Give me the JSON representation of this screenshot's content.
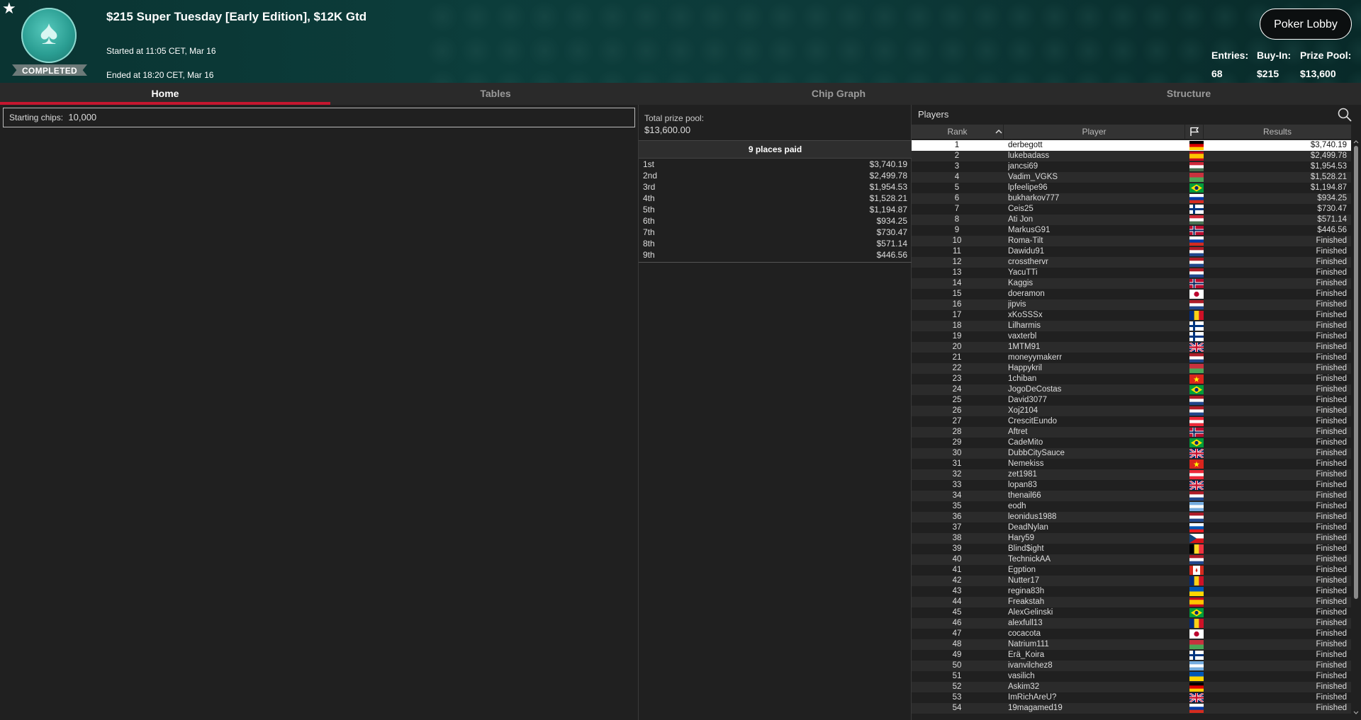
{
  "header": {
    "status_label": "COMPLETED",
    "title": "$215 Super Tuesday [Early Edition], $12K Gtd",
    "started": "Started at 11:05 CET, Mar 16",
    "ended": "Ended at 18:20 CET, Mar 16",
    "lobby_button": "Poker Lobby",
    "stats": [
      {
        "label": "Entries:",
        "value": "68"
      },
      {
        "label": "Buy-In:",
        "value": "$215"
      },
      {
        "label": "Prize Pool:",
        "value": "$13,600"
      }
    ]
  },
  "tabs": [
    {
      "label": "Home",
      "active": true
    },
    {
      "label": "Tables",
      "active": false
    },
    {
      "label": "Chip Graph",
      "active": false
    },
    {
      "label": "Structure",
      "active": false
    }
  ],
  "home": {
    "starting_chips_label": "Starting chips:",
    "starting_chips_value": "10,000"
  },
  "prize": {
    "total_label": "Total prize pool:",
    "total_value": "$13,600.00",
    "places_header": "9 places paid",
    "places": [
      {
        "place": "1st",
        "amount": "$3,740.19"
      },
      {
        "place": "2nd",
        "amount": "$2,499.78"
      },
      {
        "place": "3rd",
        "amount": "$1,954.53"
      },
      {
        "place": "4th",
        "amount": "$1,528.21"
      },
      {
        "place": "5th",
        "amount": "$1,194.87"
      },
      {
        "place": "6th",
        "amount": "$934.25"
      },
      {
        "place": "7th",
        "amount": "$730.47"
      },
      {
        "place": "8th",
        "amount": "$571.14"
      },
      {
        "place": "9th",
        "amount": "$446.56"
      }
    ]
  },
  "players": {
    "title": "Players",
    "columns": {
      "rank": "Rank",
      "player": "Player",
      "results": "Results"
    },
    "rows": [
      {
        "rank": "1",
        "name": "derbegott",
        "flag": "de",
        "result": "$3,740.19"
      },
      {
        "rank": "2",
        "name": "lukebadass",
        "flag": "es",
        "result": "$2,499.78"
      },
      {
        "rank": "3",
        "name": "jancsi69",
        "flag": "hu",
        "result": "$1,954.53"
      },
      {
        "rank": "4",
        "name": "Vadim_VGKS",
        "flag": "by",
        "result": "$1,528.21"
      },
      {
        "rank": "5",
        "name": "lpfeelipe96",
        "flag": "br",
        "result": "$1,194.87"
      },
      {
        "rank": "6",
        "name": "bukharkov777",
        "flag": "ru",
        "result": "$934.25"
      },
      {
        "rank": "7",
        "name": "Ceis25",
        "flag": "fi",
        "result": "$730.47"
      },
      {
        "rank": "8",
        "name": "Ati Jon",
        "flag": "hu",
        "result": "$571.14"
      },
      {
        "rank": "9",
        "name": "MarkusG91",
        "flag": "no",
        "result": "$446.56"
      },
      {
        "rank": "10",
        "name": "Roma-Tilt",
        "flag": "ru",
        "result": "Finished"
      },
      {
        "rank": "11",
        "name": "Dawidu91",
        "flag": "nl",
        "result": "Finished"
      },
      {
        "rank": "12",
        "name": "crossthervr",
        "flag": "nl",
        "result": "Finished"
      },
      {
        "rank": "13",
        "name": "YacuTTi",
        "flag": "nl",
        "result": "Finished"
      },
      {
        "rank": "14",
        "name": "Kaggis",
        "flag": "no",
        "result": "Finished"
      },
      {
        "rank": "15",
        "name": "doeramon",
        "flag": "jp",
        "result": "Finished"
      },
      {
        "rank": "16",
        "name": "jipvis",
        "flag": "nl",
        "result": "Finished"
      },
      {
        "rank": "17",
        "name": "xKoSSSx",
        "flag": "ro",
        "result": "Finished"
      },
      {
        "rank": "18",
        "name": "Lilharmis",
        "flag": "fi",
        "result": "Finished"
      },
      {
        "rank": "19",
        "name": "vaxterbl",
        "flag": "fi",
        "result": "Finished"
      },
      {
        "rank": "20",
        "name": "1MTM91",
        "flag": "gb",
        "result": "Finished"
      },
      {
        "rank": "21",
        "name": "moneyymakerr",
        "flag": "nl",
        "result": "Finished"
      },
      {
        "rank": "22",
        "name": "Happykril",
        "flag": "by",
        "result": "Finished"
      },
      {
        "rank": "23",
        "name": "1chiban",
        "flag": "vn",
        "result": "Finished"
      },
      {
        "rank": "24",
        "name": "JogoDeCostas",
        "flag": "br",
        "result": "Finished"
      },
      {
        "rank": "25",
        "name": "David3077",
        "flag": "nl",
        "result": "Finished"
      },
      {
        "rank": "26",
        "name": "Xoj2104",
        "flag": "nl",
        "result": "Finished"
      },
      {
        "rank": "27",
        "name": "CrescitEundo",
        "flag": "at",
        "result": "Finished"
      },
      {
        "rank": "28",
        "name": "Aftret",
        "flag": "no",
        "result": "Finished"
      },
      {
        "rank": "29",
        "name": "CadeMito",
        "flag": "br",
        "result": "Finished"
      },
      {
        "rank": "30",
        "name": "DubbCitySauce",
        "flag": "gb",
        "result": "Finished"
      },
      {
        "rank": "31",
        "name": "Nemekiss",
        "flag": "vn",
        "result": "Finished"
      },
      {
        "rank": "32",
        "name": "zet1981",
        "flag": "at",
        "result": "Finished"
      },
      {
        "rank": "33",
        "name": "lopan83",
        "flag": "gb",
        "result": "Finished"
      },
      {
        "rank": "34",
        "name": "thenail66",
        "flag": "nl",
        "result": "Finished"
      },
      {
        "rank": "35",
        "name": "eodh",
        "flag": "ar",
        "result": "Finished"
      },
      {
        "rank": "36",
        "name": "leonidus1988",
        "flag": "nl",
        "result": "Finished"
      },
      {
        "rank": "37",
        "name": "DeadNylan",
        "flag": "si",
        "result": "Finished"
      },
      {
        "rank": "38",
        "name": "Hary59",
        "flag": "cz",
        "result": "Finished"
      },
      {
        "rank": "39",
        "name": "Blind$ight",
        "flag": "be",
        "result": "Finished"
      },
      {
        "rank": "40",
        "name": "TechnickAA",
        "flag": "nl",
        "result": "Finished"
      },
      {
        "rank": "41",
        "name": "Egption",
        "flag": "ca",
        "result": "Finished"
      },
      {
        "rank": "42",
        "name": "Nutter17",
        "flag": "ro",
        "result": "Finished"
      },
      {
        "rank": "43",
        "name": "regina83h",
        "flag": "ua",
        "result": "Finished"
      },
      {
        "rank": "44",
        "name": "Freakstah",
        "flag": "es",
        "result": "Finished"
      },
      {
        "rank": "45",
        "name": "AlexGelinski",
        "flag": "br",
        "result": "Finished"
      },
      {
        "rank": "46",
        "name": "alexfull13",
        "flag": "ro",
        "result": "Finished"
      },
      {
        "rank": "47",
        "name": "cocacota",
        "flag": "jp",
        "result": "Finished"
      },
      {
        "rank": "48",
        "name": "Natrium111",
        "flag": "by",
        "result": "Finished"
      },
      {
        "rank": "49",
        "name": "Erä_Koira",
        "flag": "fi",
        "result": "Finished"
      },
      {
        "rank": "50",
        "name": "ivanvilchez8",
        "flag": "ar",
        "result": "Finished"
      },
      {
        "rank": "51",
        "name": "vasilich",
        "flag": "ua",
        "result": "Finished"
      },
      {
        "rank": "52",
        "name": "Askim32",
        "flag": "de",
        "result": "Finished"
      },
      {
        "rank": "53",
        "name": "ImRichAreU?",
        "flag": "gb",
        "result": "Finished"
      },
      {
        "rank": "54",
        "name": "19magamed19",
        "flag": "ru",
        "result": "Finished"
      }
    ]
  },
  "colors": {
    "accent_red": "#c5162f",
    "header_teal": "#0c3d3b",
    "panel_bg": "#202020"
  },
  "icons": {
    "favorite": "star-icon",
    "search": "search-icon",
    "sort": "caret-up-icon",
    "country": "flag-icon"
  }
}
